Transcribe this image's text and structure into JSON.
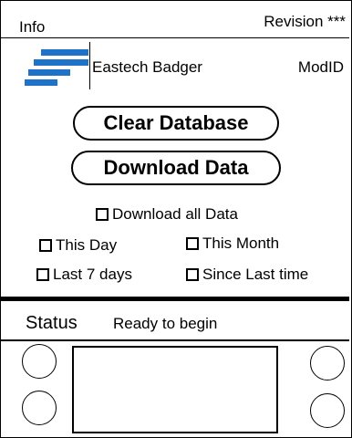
{
  "header": {
    "title": "Info",
    "revision": "Revision ***"
  },
  "brand": {
    "logo_icon": "eastech-logo-icon",
    "name": "Eastech Badger",
    "mod_id": "ModID",
    "logo_color": "#1e73c8"
  },
  "buttons": {
    "clear_database": "Clear Database",
    "download_data": "Download Data"
  },
  "options": {
    "download_all": {
      "label": "Download all Data",
      "checked": false
    },
    "this_day": {
      "label": "This Day",
      "checked": false
    },
    "this_month": {
      "label": "This Month",
      "checked": false
    },
    "last_7_days": {
      "label": "Last 7 days",
      "checked": false
    },
    "since_last_time": {
      "label": "Since Last time",
      "checked": false
    }
  },
  "status": {
    "label": "Status",
    "text": "Ready to begin"
  }
}
